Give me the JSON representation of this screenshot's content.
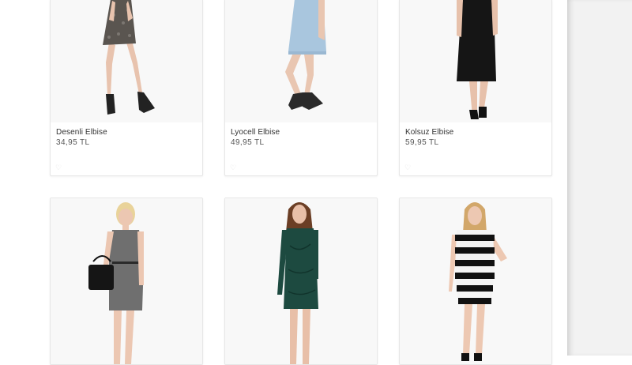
{
  "products": [
    {
      "name": "Desenli Elbise",
      "price": "34,95 TL",
      "image": "patterned-dress-model-photo"
    },
    {
      "name": "Lyocell Elbise",
      "price": "49,95 TL",
      "image": "denim-dress-model-photo"
    },
    {
      "name": "Kolsuz Elbise",
      "price": "59,95 TL",
      "image": "black-jumpsuit-model-photo"
    },
    {
      "name": "",
      "price": "",
      "image": "grey-dress-with-handbag-model-photo"
    },
    {
      "name": "",
      "price": "",
      "image": "green-bodycon-dress-model-photo"
    },
    {
      "name": "",
      "price": "",
      "image": "striped-dress-model-photo"
    }
  ],
  "colors": {
    "background": "#ffffff",
    "gutter": "#f2f2f2",
    "card_border": "#e7e7e7",
    "image_bg": "#f8f8f8"
  }
}
